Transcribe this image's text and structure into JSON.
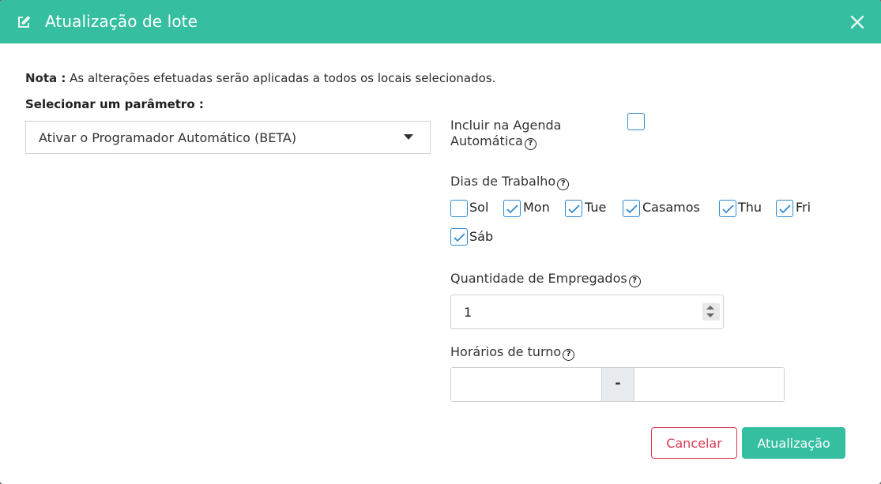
{
  "header": {
    "title": "Atualização de lote",
    "icon": "edit-icon",
    "close_icon": "close-icon",
    "color": "#35bfa0"
  },
  "note": {
    "label": "Nota :",
    "text": " As alterações efetuadas serão aplicadas a todos os locais selecionados."
  },
  "parameter": {
    "label": "Selecionar um parâmetro :",
    "selected": "Ativar o Programador Automático (BETA)"
  },
  "include_schedule": {
    "label_line1": "Incluir na Agenda",
    "label_line2": "Automática",
    "checked": false
  },
  "work_days": {
    "label": "Dias de Trabalho",
    "days": [
      {
        "label": "Sol",
        "checked": false
      },
      {
        "label": "Mon",
        "checked": true
      },
      {
        "label": "Tue",
        "checked": true
      },
      {
        "label": "Casamos",
        "checked": true
      },
      {
        "label": "Thu",
        "checked": true
      },
      {
        "label": "Fri",
        "checked": true
      },
      {
        "label": "Sáb",
        "checked": true
      }
    ]
  },
  "employees": {
    "label": "Quantidade de Empregados",
    "value": "1"
  },
  "shift": {
    "label": "Horários de turno",
    "start": "",
    "separator": "-",
    "end": ""
  },
  "buttons": {
    "cancel": "Cancelar",
    "update": "Atualização"
  },
  "help_glyph": "?"
}
